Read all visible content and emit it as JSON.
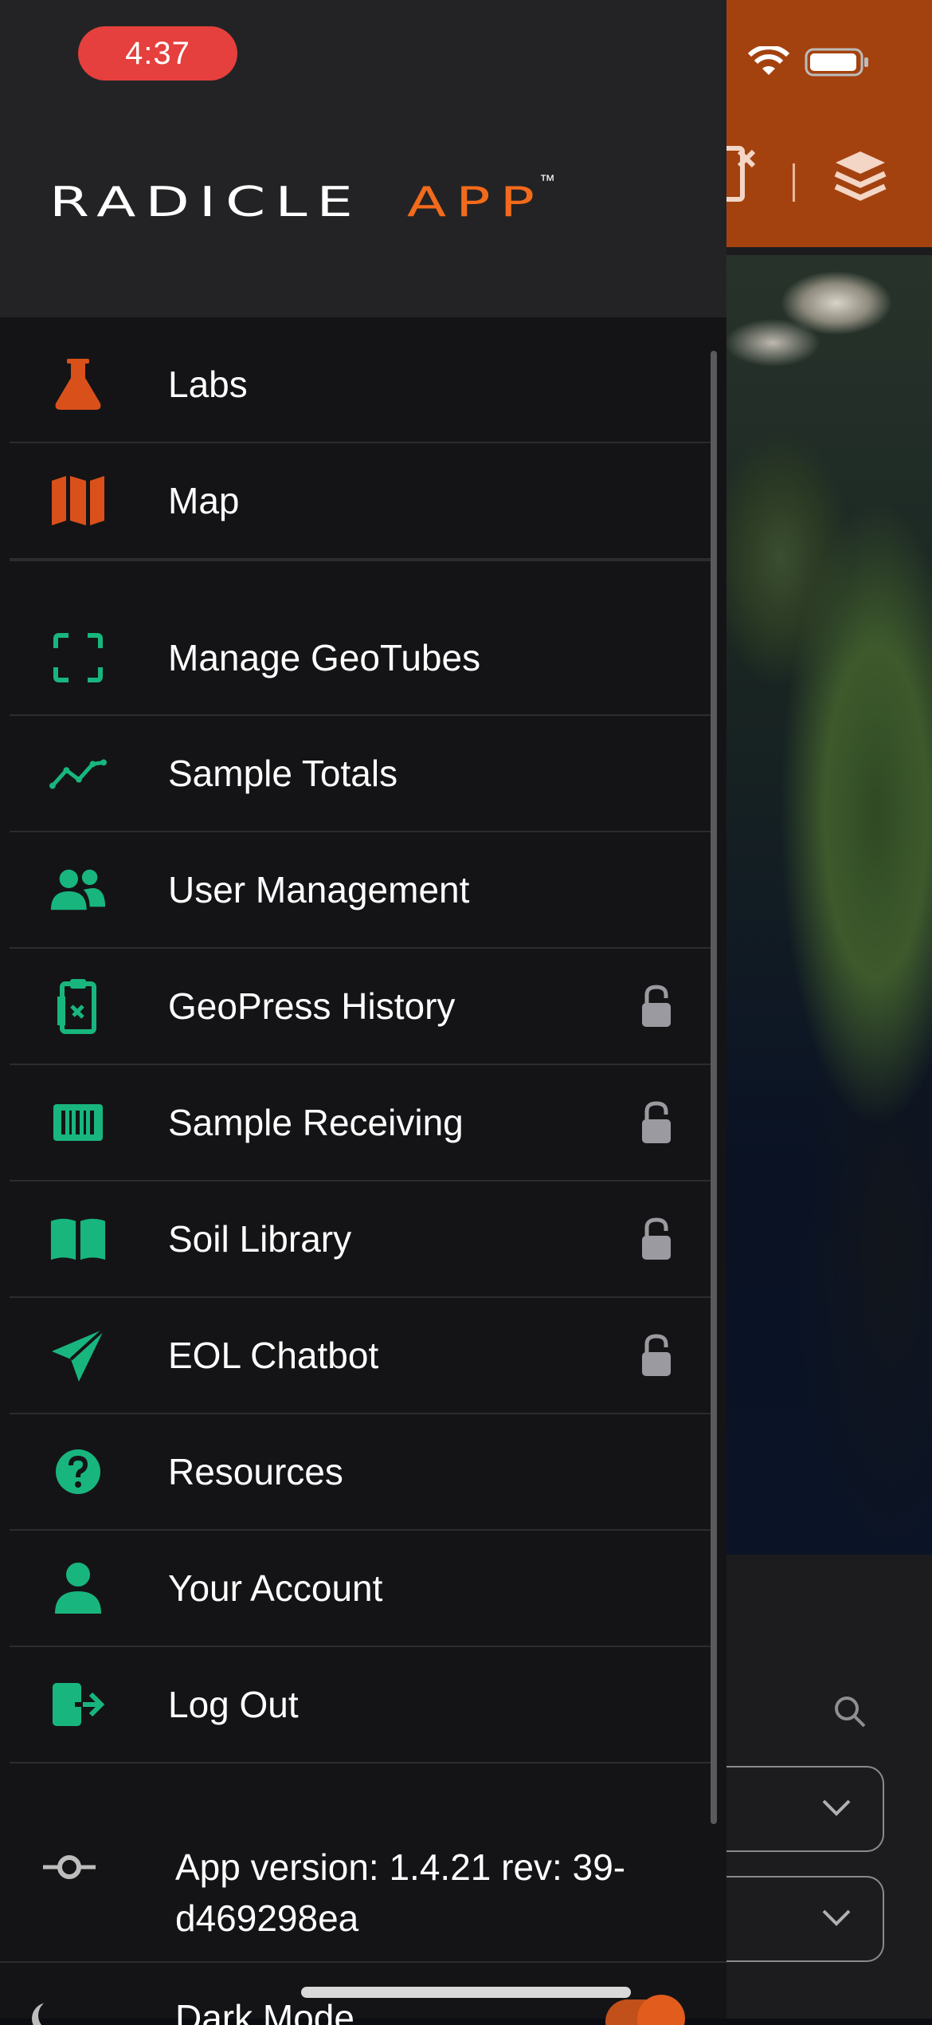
{
  "status_bar": {
    "time": "4:37"
  },
  "header": {
    "logo_word": "RADICLE",
    "logo_app": "APP",
    "logo_tm": "™",
    "accent_color": "#f26a1b"
  },
  "menu": {
    "items": [
      {
        "label": "Labs",
        "icon": "flask-icon",
        "color": "#d9501b",
        "locked": false
      },
      {
        "label": "Map",
        "icon": "map-icon",
        "color": "#d9501b",
        "locked": false
      },
      {
        "label": "Manage GeoTubes",
        "icon": "scan-frame-icon",
        "color": "#18b67e",
        "locked": false
      },
      {
        "label": "Sample Totals",
        "icon": "trend-line-icon",
        "color": "#18b67e",
        "locked": false
      },
      {
        "label": "User Management",
        "icon": "users-icon",
        "color": "#18b67e",
        "locked": false
      },
      {
        "label": "GeoPress History",
        "icon": "clipboard-history-icon",
        "color": "#18b67e",
        "locked": true
      },
      {
        "label": "Sample Receiving",
        "icon": "barcode-icon",
        "color": "#18b67e",
        "locked": true
      },
      {
        "label": "Soil Library",
        "icon": "book-icon",
        "color": "#18b67e",
        "locked": true
      },
      {
        "label": "EOL Chatbot",
        "icon": "paper-plane-icon",
        "color": "#18b67e",
        "locked": true
      },
      {
        "label": "Resources",
        "icon": "question-circle-icon",
        "color": "#18b67e",
        "locked": false
      },
      {
        "label": "Your Account",
        "icon": "user-icon",
        "color": "#18b67e",
        "locked": false
      },
      {
        "label": "Log Out",
        "icon": "logout-icon",
        "color": "#18b67e",
        "locked": false
      }
    ]
  },
  "version": {
    "text": "App version: 1.4.21 rev: 39-d469298ea"
  },
  "dark_mode": {
    "label": "Dark Mode",
    "enabled": true
  }
}
